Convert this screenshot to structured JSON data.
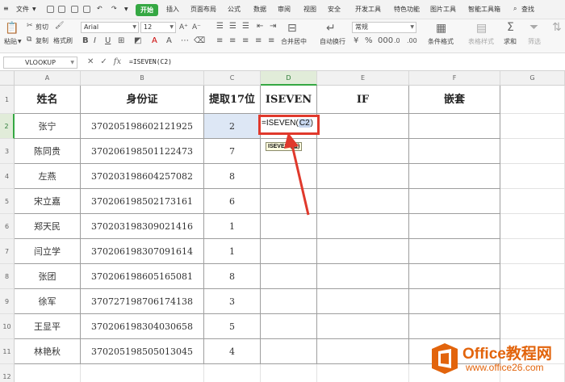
{
  "menu": {
    "file": "文件",
    "tabs": [
      "开始",
      "插入",
      "页面布局",
      "公式",
      "数据",
      "审阅",
      "视图",
      "安全",
      "开发工具",
      "特色功能",
      "图片工具",
      "智能工具箱"
    ],
    "active_tab": "开始",
    "search": "查找"
  },
  "ribbon": {
    "paste": "粘贴",
    "cut": "剪切",
    "copy": "复制",
    "format_painter": "格式刷",
    "font_name": "Arial",
    "font_size": "12",
    "merge_center": "合并居中",
    "wrap_text": "自动换行",
    "number_format": "常规",
    "conditional_format": "条件格式",
    "table_style": "表格样式",
    "sum": "求和",
    "filter": "筛选"
  },
  "formula_bar": {
    "name_box": "VLOOKUP",
    "formula": "=ISEVEN(C2)"
  },
  "grid": {
    "columns": [
      "A",
      "B",
      "C",
      "D",
      "E",
      "F",
      "G"
    ],
    "rows": [
      "1",
      "2",
      "3",
      "4",
      "5",
      "6",
      "7",
      "8",
      "9",
      "10",
      "11",
      "12"
    ],
    "headers": {
      "name": "姓名",
      "id": "身份证",
      "digit": "提取17位",
      "iseven": "ISEVEN",
      "if": "IF",
      "nested": "嵌套"
    },
    "data": [
      {
        "name": "张宁",
        "id": "370205198602121925",
        "digit": "2"
      },
      {
        "name": "陈同贵",
        "id": "370206198501122473",
        "digit": "7"
      },
      {
        "name": "左燕",
        "id": "370203198604257082",
        "digit": "8"
      },
      {
        "name": "宋立嘉",
        "id": "370206198502173161",
        "digit": "6"
      },
      {
        "name": "郑天民",
        "id": "370203198309021416",
        "digit": "1"
      },
      {
        "name": "闫立学",
        "id": "370206198307091614",
        "digit": "1"
      },
      {
        "name": "张团",
        "id": "370206198605165081",
        "digit": "8"
      },
      {
        "name": "徐军",
        "id": "370727198706174138",
        "digit": "3"
      },
      {
        "name": "王显平",
        "id": "370206198304030658",
        "digit": "5"
      },
      {
        "name": "林艳秋",
        "id": "370205198505013045",
        "digit": "4"
      }
    ],
    "editing": {
      "prefix": "=ISEVEN(",
      "ref": "C2",
      "suffix": ")",
      "tooltip": "ISEVEN (值)"
    }
  },
  "watermark": {
    "title": "Office教程网",
    "url": "www.office26.com"
  },
  "colors": {
    "accent": "#35a843",
    "highlight_border": "#e0392c",
    "watermark": "#e2640c"
  }
}
